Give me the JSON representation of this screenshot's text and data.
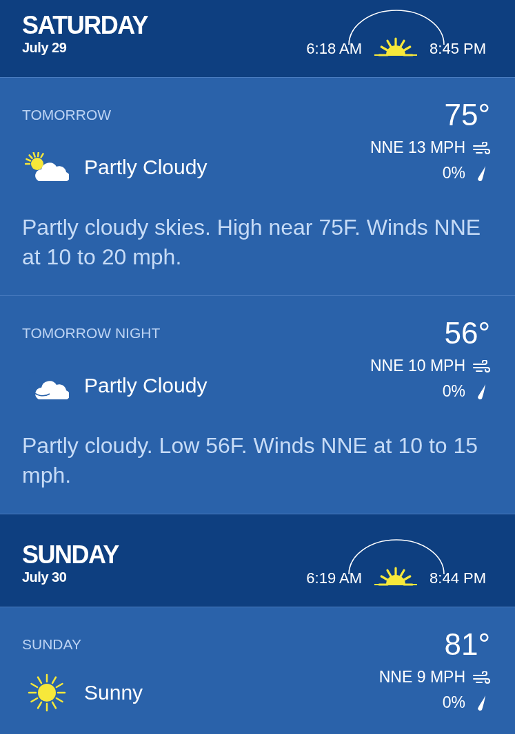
{
  "days": [
    {
      "name": "SATURDAY",
      "date": "July 29",
      "sunrise": "6:18 AM",
      "sunset": "8:45 PM",
      "periods": [
        {
          "label": "TOMORROW",
          "temp": "75°",
          "wind": "NNE 13 MPH",
          "precip": "0%",
          "kind": "partly-cloudy-day",
          "condition": "Partly Cloudy",
          "description": "Partly cloudy skies. High near 75F. Winds NNE at 10 to 20 mph."
        },
        {
          "label": "TOMORROW NIGHT",
          "temp": "56°",
          "wind": "NNE 10 MPH",
          "precip": "0%",
          "kind": "partly-cloudy-night",
          "condition": "Partly Cloudy",
          "description": "Partly cloudy. Low 56F. Winds NNE at 10 to 15 mph."
        }
      ]
    },
    {
      "name": "SUNDAY",
      "date": "July 30",
      "sunrise": "6:19 AM",
      "sunset": "8:44 PM",
      "periods": [
        {
          "label": "SUNDAY",
          "temp": "81°",
          "wind": "NNE 9 MPH",
          "precip": "0%",
          "kind": "sunny",
          "condition": "Sunny"
        }
      ]
    }
  ]
}
